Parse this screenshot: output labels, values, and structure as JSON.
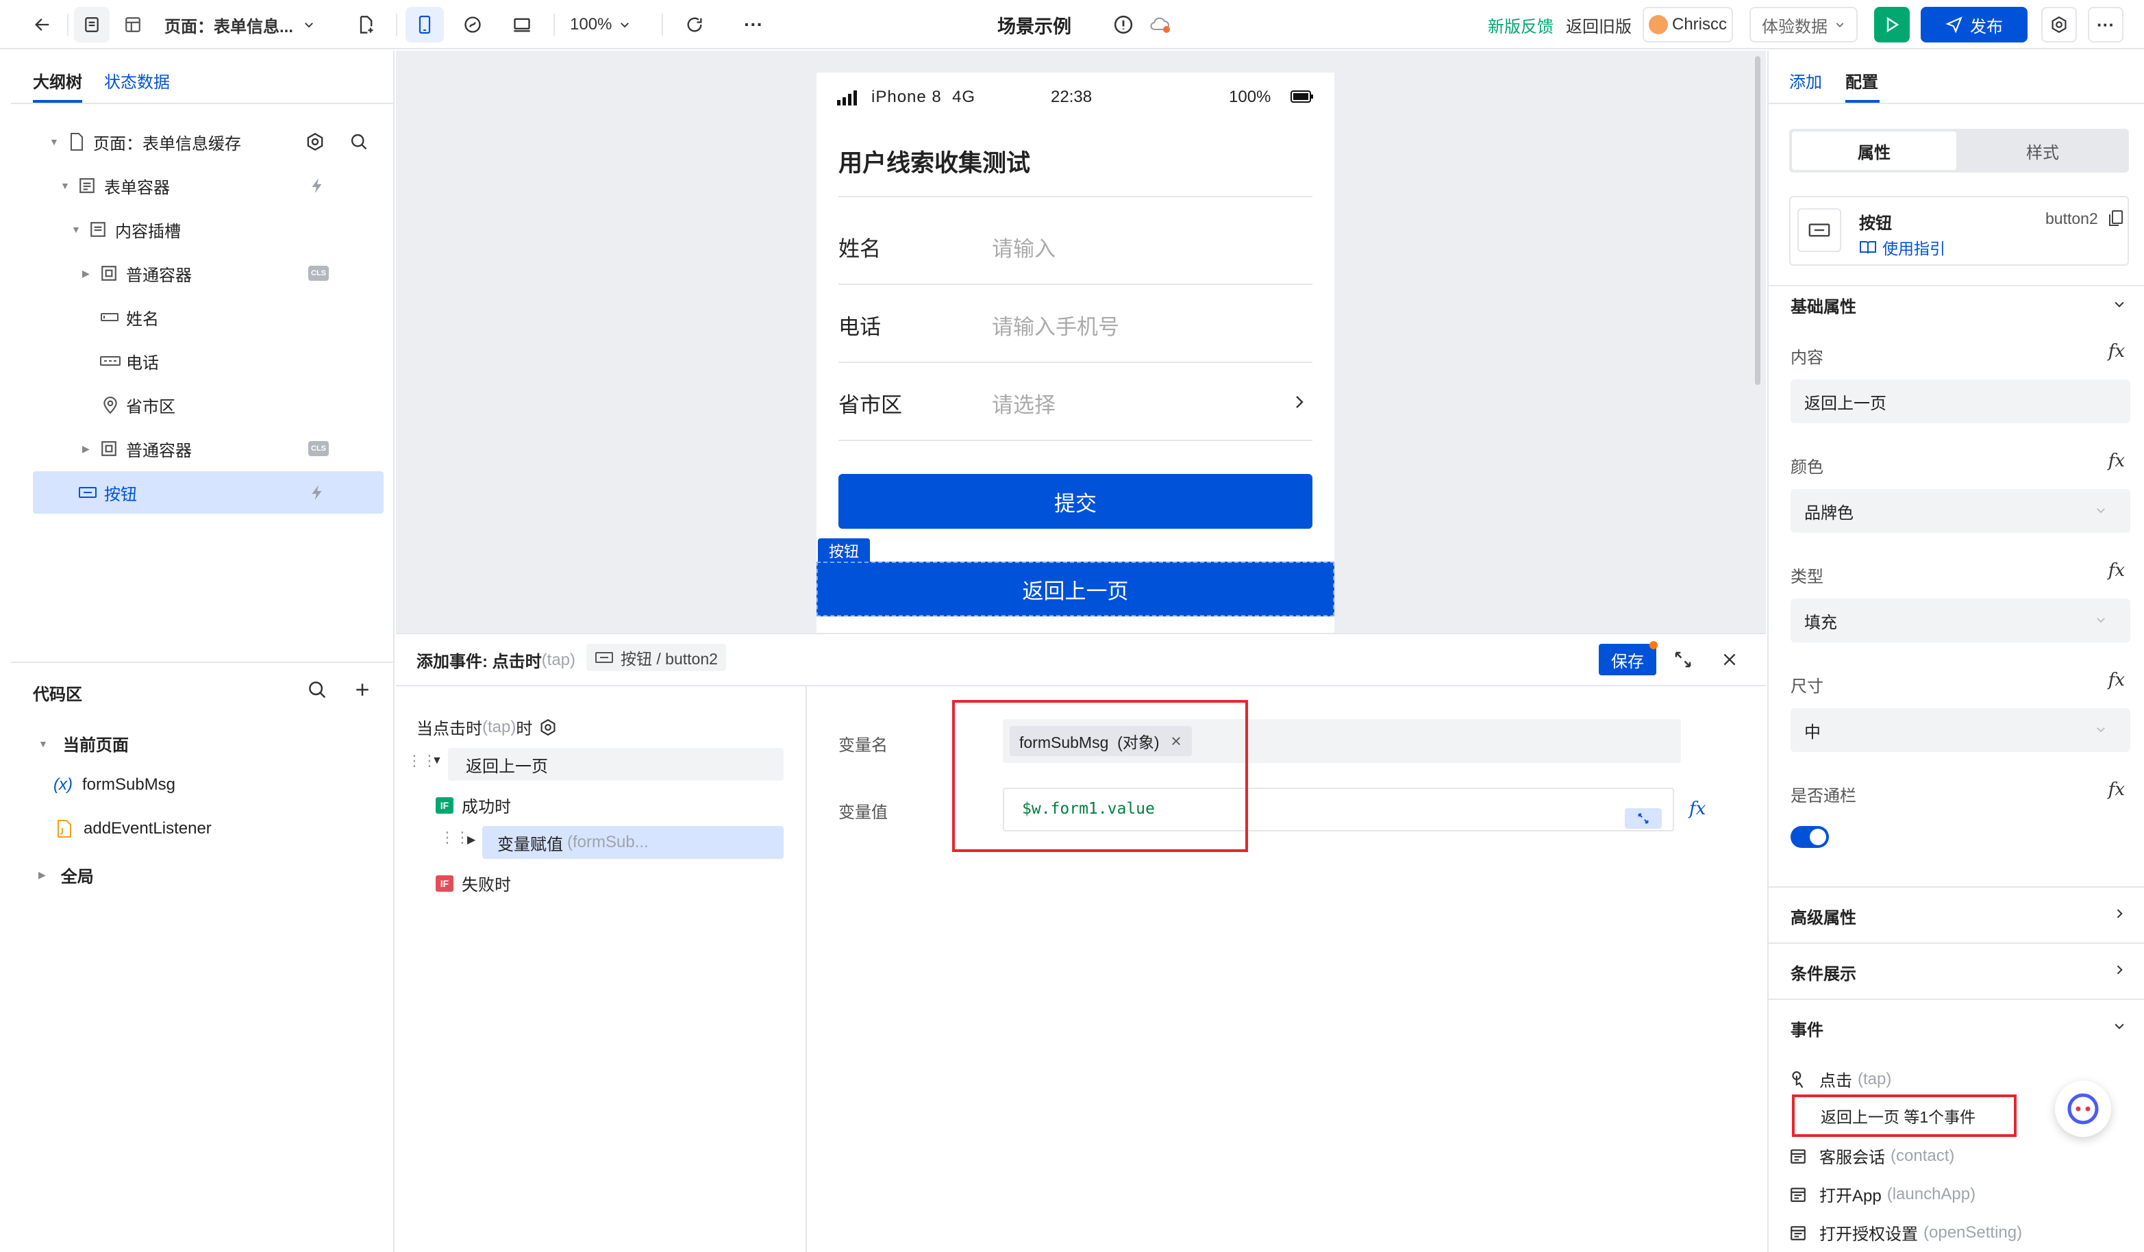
{
  "topbar": {
    "page_select": "页面：表单信息...",
    "zoom": "100%",
    "scene_title": "场景示例",
    "feedback": "新版反馈",
    "back_old": "返回旧版",
    "user": "Chriscc",
    "data_select": "体验数据",
    "publish": "发布",
    "more": "···"
  },
  "left": {
    "tabs": [
      "大纲树",
      "状态数据"
    ],
    "tree": [
      {
        "label": "页面：表单信息缓存"
      },
      {
        "label": "表单容器"
      },
      {
        "label": "内容插槽"
      },
      {
        "label": "普通容器",
        "badge": "CLS"
      },
      {
        "label": "姓名"
      },
      {
        "label": "电话"
      },
      {
        "label": "省市区"
      },
      {
        "label": "普通容器",
        "badge": "CLS"
      },
      {
        "label": "按钮"
      }
    ],
    "code_title": "代码区",
    "code": {
      "current_page": "当前页面",
      "var_prefix": "(x)",
      "var_name": "formSubMsg",
      "listener": "addEventListener",
      "global": "全局"
    }
  },
  "phone": {
    "carrier": "iPhone 8  4G",
    "time": "22:38",
    "battery": "100%",
    "title": "用户线索收集测试",
    "fields": [
      {
        "label": "姓名",
        "placeholder": "请输入"
      },
      {
        "label": "电话",
        "placeholder": "请输入手机号"
      },
      {
        "label": "省市区",
        "placeholder": "请选择"
      }
    ],
    "submit": "提交",
    "selected_tag": "按钮",
    "back_button": "返回上一页"
  },
  "event": {
    "title": "添加事件: 点击时",
    "title_suffix": "(tap)",
    "crumb": "按钮 / button2",
    "save": "保存",
    "trigger": "当点击时",
    "trigger_suffix": "(tap)",
    "trigger_end": "时",
    "action": "返回上一页",
    "success": "成功时",
    "assign": "变量赋值",
    "assign_suffix": "(formSub...",
    "fail": "失败时",
    "var_name_label": "变量名",
    "var_tag": "formSubMsg  (对象)",
    "var_value_label": "变量值",
    "var_value": "$w.form1.value"
  },
  "right": {
    "tabs": [
      "添加",
      "配置"
    ],
    "segments": [
      "属性",
      "样式"
    ],
    "comp_name": "按钮",
    "comp_guide": "使用指引",
    "comp_id": "button2",
    "basic": "基础属性",
    "props": [
      {
        "label": "内容",
        "value": "返回上一页"
      },
      {
        "label": "颜色",
        "value": "品牌色"
      },
      {
        "label": "类型",
        "value": "填充"
      },
      {
        "label": "尺寸",
        "value": "中"
      }
    ],
    "block_label": "是否通栏",
    "advanced": "高级属性",
    "condition": "条件展示",
    "events": "事件",
    "event_items": [
      {
        "name": "点击",
        "code": "(tap)"
      },
      {
        "name": "客服会话",
        "code": "(contact)"
      },
      {
        "name": "打开App",
        "code": "(launchApp)"
      },
      {
        "name": "打开授权设置",
        "code": "(openSetting)"
      }
    ],
    "tap_summary": "返回上一页 等1个事件"
  },
  "colors": {
    "brand": "#0052d9",
    "green": "#00a870",
    "highlight": "#e6262d",
    "selected_bg": "#d6e4ff"
  }
}
